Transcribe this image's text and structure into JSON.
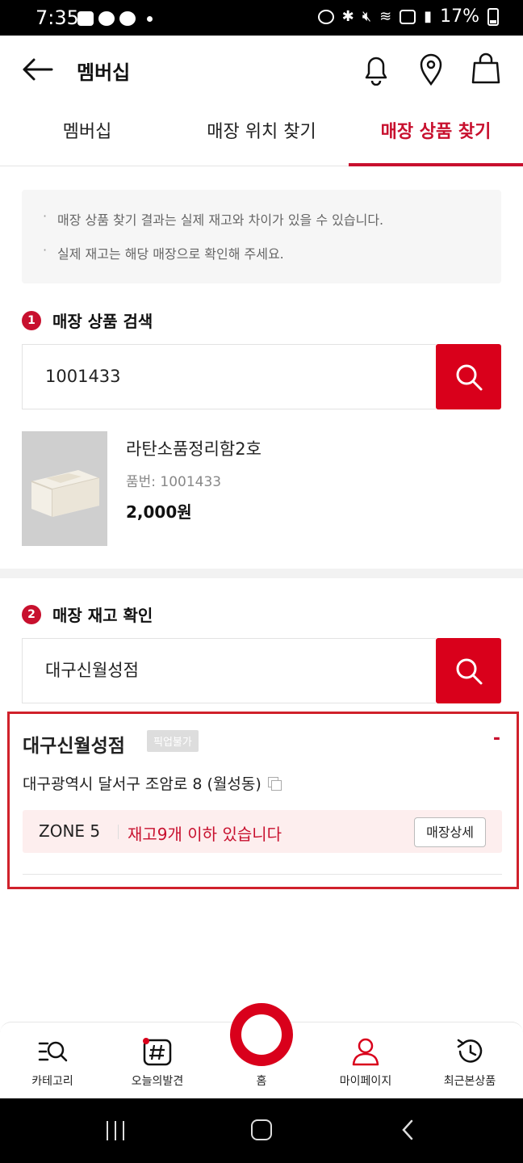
{
  "status_bar": {
    "time": "7:35",
    "battery": "17%"
  },
  "header": {
    "title": "멤버십"
  },
  "tabs": [
    {
      "label": "멤버십",
      "active": false
    },
    {
      "label": "매장 위치 찾기",
      "active": false
    },
    {
      "label": "매장 상품 찾기",
      "active": true
    }
  ],
  "notice": [
    "매장 상품 찾기 결과는 실제 재고와 차이가 있을 수 있습니다.",
    "실제 재고는 해당 매장으로 확인해 주세요."
  ],
  "section1": {
    "number": "1",
    "title": "매장 상품 검색",
    "search_value": "1001433"
  },
  "product": {
    "name": "라탄소품정리함2호",
    "code": "품번: 1001433",
    "price": "2,000원"
  },
  "section2": {
    "number": "2",
    "title": "매장 재고 확인",
    "search_value": "대구신월성점"
  },
  "result": {
    "store_name": "대구신월성점",
    "pickup_badge": "픽업불가",
    "collapse": "-",
    "address": "대구광역시 달서구 조암로 8 (월성동)",
    "zone": "ZONE 5",
    "stock": "재고9개 이하 있습니다",
    "detail_button": "매장상세"
  },
  "bottom_nav": [
    {
      "label": "카테고리",
      "icon": "category-search-icon"
    },
    {
      "label": "오늘의발견",
      "icon": "hashtag-icon"
    },
    {
      "label": "홈",
      "icon": "home-ring-icon"
    },
    {
      "label": "마이페이지",
      "icon": "person-icon"
    },
    {
      "label": "최근본상품",
      "icon": "history-icon"
    }
  ],
  "colors": {
    "accent": "#c8102e",
    "button": "#d9001b",
    "zone_bg": "#fdeeee"
  }
}
